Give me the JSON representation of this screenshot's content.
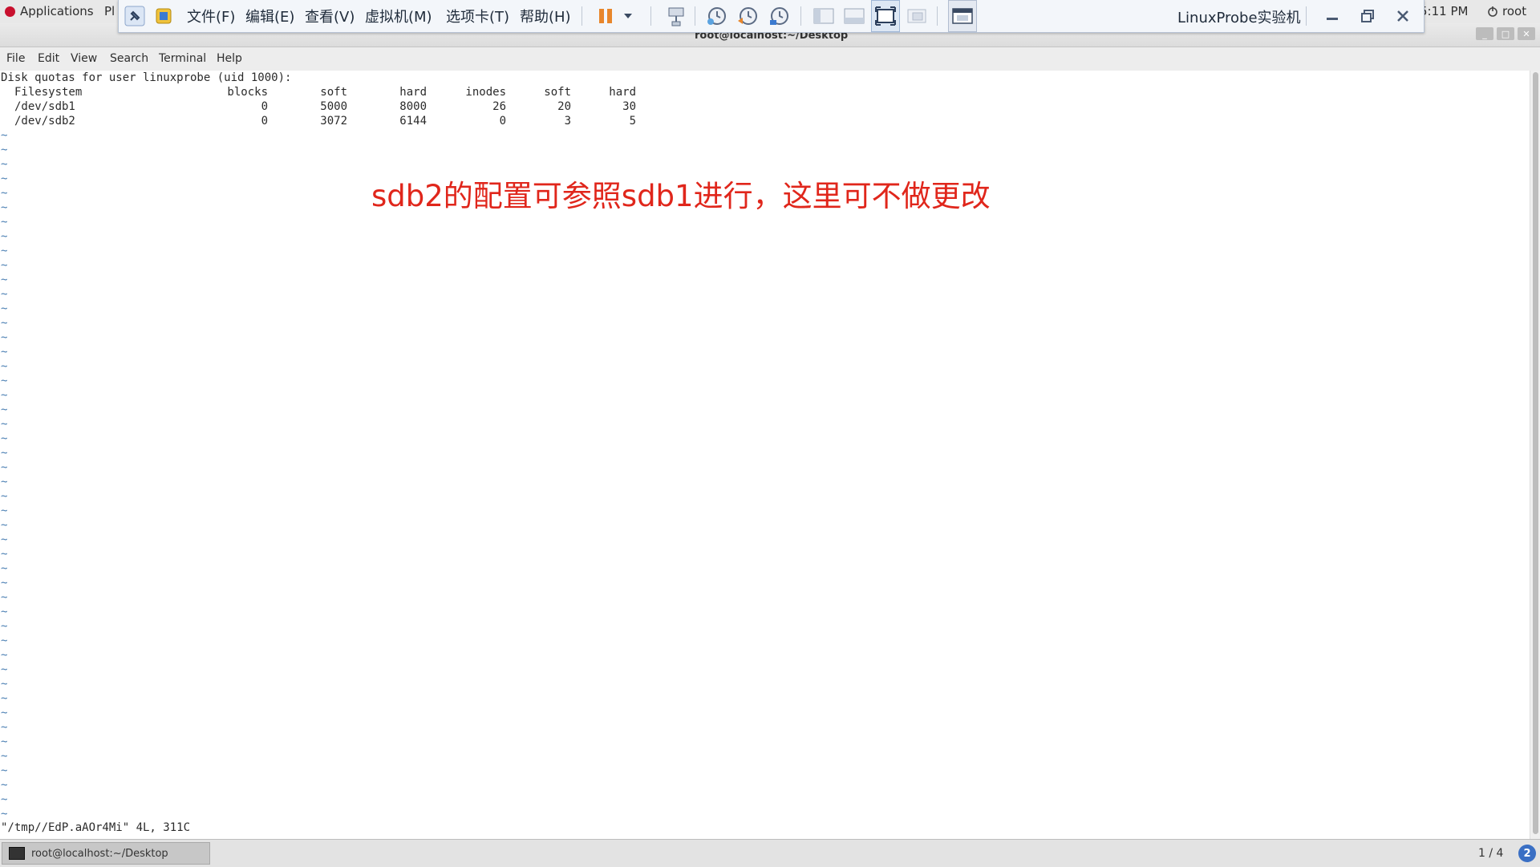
{
  "panel": {
    "applications": "Applications",
    "places_fragment": "Pl",
    "clock": "5:11 PM",
    "user": "root"
  },
  "vm_toolbar": {
    "menus": [
      "文件(F)",
      "编辑(E)",
      "查看(V)",
      "虚拟机(M)",
      "选项卡(T)",
      "帮助(H)"
    ],
    "title": "LinuxProbe实验机",
    "pause_color": "#e8862b"
  },
  "terminal": {
    "window_title": "root@localhost:~/Desktop",
    "menu": [
      "File",
      "Edit",
      "View",
      "Search",
      "Terminal",
      "Help"
    ],
    "quota_header": "Disk quotas for user linuxprobe (uid 1000):",
    "columns": [
      "Filesystem",
      "blocks",
      "soft",
      "hard",
      "inodes",
      "soft",
      "hard"
    ],
    "rows": [
      {
        "filesystem": "/dev/sdb1",
        "blocks": "0",
        "soft": "5000",
        "hard": "8000",
        "inodes": "26",
        "isoft": "20",
        "ihard": "30"
      },
      {
        "filesystem": "/dev/sdb2",
        "blocks": "0",
        "soft": "3072",
        "hard": "6144",
        "inodes": "0",
        "isoft": "3",
        "ihard": "5"
      }
    ],
    "tilde": "~",
    "status_line": "\"/tmp//EdP.aAOr4Mi\" 4L, 311C"
  },
  "annotation": {
    "text": "sdb2的配置可参照sdb1进行，这里可不做更改",
    "color": "#e0261b"
  },
  "taskbar": {
    "task_label": "root@localhost:~/Desktop",
    "workspace": "1 / 4",
    "help": "2"
  }
}
